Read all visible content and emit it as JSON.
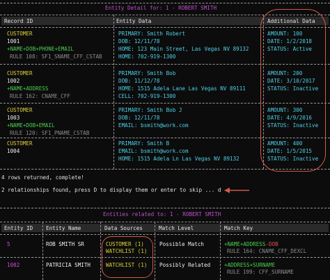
{
  "top": {
    "title": "Entity Detail for: 1 - ROBERT SMITH",
    "headers": [
      "Record ID",
      "Entity Data",
      "Additional Data"
    ],
    "rows": [
      {
        "source": "CUSTOMER",
        "id": "1001",
        "match": "+NAME+DOB+PHONE+EMAIL",
        "rule": "RULE 108: SF1_SNAME_CFF_CSTAB",
        "data": [
          "PRIMARY: Smith Robert",
          "DOB: 12/11/78",
          "HOME: 123 Main Street, Las Vegas NV 89132",
          "HOME: 702-919-1300"
        ],
        "extra": [
          "AMOUNT: 100",
          "DATE: 1/2/2018",
          "STATUS: Active"
        ]
      },
      {
        "source": "CUSTOMER",
        "id": "1002",
        "match": "+NAME+ADDRESS",
        "rule": "RULE 162: CNAME_CFF",
        "data": [
          "PRIMARY: Smith Bob",
          "DOB: 11/12/78",
          "HOME: 1515 Adela Lane Las Vegas NV 89111",
          "CELL: 702-919-1300"
        ],
        "extra": [
          "AMOUNT: 200",
          "DATE: 3/10/2017",
          "STATUS: Inactive"
        ]
      },
      {
        "source": "CUSTOMER",
        "id": "1003",
        "match": "+NAME+DOB+EMAIL",
        "rule": "RULE 120: SF1_PNAME_CSTAB",
        "data": [
          "PRIMARY: Smith Bob J",
          "DOB: 12/11/78",
          "EMAIL: bsmith@work.com",
          ""
        ],
        "extra": [
          "AMOUNT: 300",
          "DATE: 4/9/2016",
          "STATUS: Inactive"
        ]
      },
      {
        "source": "CUSTOMER",
        "id": "1004",
        "match": "",
        "rule": "",
        "data": [
          "PRIMARY: Smith B",
          "EMAIL: bsmith@work.com",
          "HOME: 1515 Adela Ln Las Vegas NV 89132",
          ""
        ],
        "extra": [
          "AMOUNT: 400",
          "DATE: 1/5/2015",
          "STATUS: Inactive"
        ]
      }
    ]
  },
  "rows_returned": "4 rows returned, complete!",
  "prompt": "2 relationships found, press D to display them or enter to skip ... d",
  "bottom": {
    "title": "Entities related to: 1 - ROBERT SMITH",
    "headers": [
      "Entity ID",
      "Entity Name",
      "Data Sources",
      "Match Level",
      "Match Key"
    ],
    "rows": [
      {
        "id": "5",
        "name": "ROB SMITH SR",
        "sources": [
          "CUSTOMER (1)",
          "WATCHLIST (1)"
        ],
        "level": "Possible Match",
        "key": "+NAME+ADDRESS-DOB",
        "rule": "RULE 164: CNAME_CFF_DEXCL"
      },
      {
        "id": "1002",
        "name": "PATRICIA SMITH",
        "sources": [
          "WATCHLIST (1)"
        ],
        "level": "Possibly Related",
        "key": "+ADDRESS+SURNAME",
        "rule": "RULE 199: CFF_SURNAME"
      }
    ]
  }
}
